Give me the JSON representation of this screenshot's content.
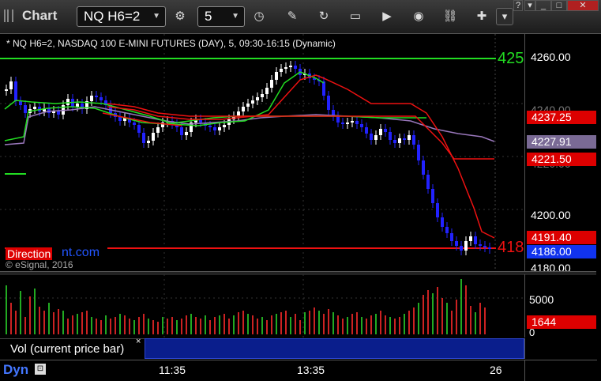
{
  "toolbar": {
    "title": "Chart",
    "symbol": "NQ H6=2",
    "interval": "5",
    "icons": [
      "chart-settings-icon",
      "clock-icon",
      "pencil-icon",
      "cycle-icon",
      "get-icon",
      "play-icon",
      "link-icon",
      "pin-icon"
    ]
  },
  "chart": {
    "title": "* NQ H6=2, NASDAQ 100 E-MINI FUTURES (DAY), 5, 09:30-16:15 (Dynamic)",
    "price_tags": {
      "top_line": "425",
      "bottom_line": "418",
      "red1": "4237.25",
      "gray": "4227.91",
      "red2": "4221.50",
      "red3": "4191.40",
      "last": "4186.00"
    },
    "y_ticks": [
      "4260.00",
      "4240.00",
      "4220.00",
      "4200.00",
      "4180.00"
    ],
    "watermark_brand": "Direction",
    "watermark_suffix": "nt.com",
    "copyright": "© eSignal, 2016"
  },
  "volume": {
    "legend": "Vol (current price bar)",
    "close_symbol": "×",
    "y_ticks": [
      "5000",
      "0"
    ],
    "last_tag": "1644"
  },
  "xaxis": {
    "left_label": "Dyn",
    "ticks": [
      "11:35",
      "13:35",
      "26"
    ]
  },
  "colors": {
    "up_candle": "#ffffff",
    "down_candle": "#2222ff",
    "green_line": "#22dd22",
    "red_line": "#ee1111",
    "purple_line": "#9977bb",
    "axis_blue": "#1133ee",
    "tag_red": "#dd0000"
  }
}
